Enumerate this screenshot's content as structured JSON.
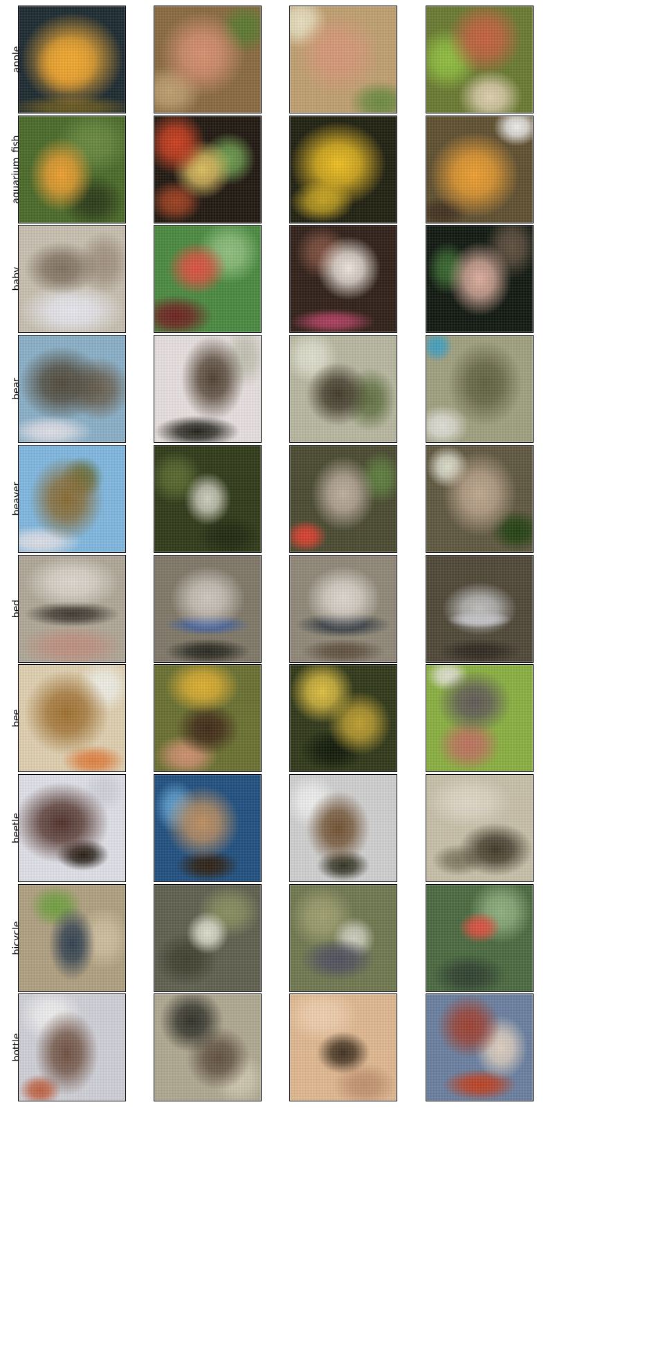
{
  "rows": [
    {
      "label": "apple",
      "images": [
        {
          "bg": "#1c2a30",
          "blobs": [
            [
              "#f0a830",
              50,
              50,
              48,
              44
            ],
            [
              "#e89020",
              45,
              55,
              30,
              28
            ],
            [
              "#6a5a20",
              50,
              95,
              60,
              12
            ]
          ]
        },
        {
          "bg": "#8a6a40",
          "blobs": [
            [
              "#d89070",
              45,
              45,
              40,
              40
            ],
            [
              "#5a7a30",
              85,
              20,
              25,
              25
            ],
            [
              "#c0a070",
              15,
              80,
              30,
              25
            ]
          ]
        },
        {
          "bg": "#c0a070",
          "blobs": [
            [
              "#d89878",
              45,
              45,
              40,
              40
            ],
            [
              "#e8e0c0",
              10,
              15,
              25,
              25
            ],
            [
              "#6a8a40",
              85,
              90,
              30,
              20
            ]
          ]
        },
        {
          "bg": "#6a7a30",
          "blobs": [
            [
              "#c86040",
              55,
              30,
              35,
              35
            ],
            [
              "#90c040",
              20,
              50,
              30,
              30
            ],
            [
              "#e0d0b0",
              60,
              85,
              30,
              25
            ]
          ]
        }
      ]
    },
    {
      "label": "aquarium_fish",
      "images": [
        {
          "bg": "#4a6a28",
          "blobs": [
            [
              "#f0a030",
              40,
              55,
              30,
              35
            ],
            [
              "#6a8a40",
              70,
              25,
              35,
              30
            ],
            [
              "#2a3a18",
              70,
              80,
              30,
              25
            ]
          ]
        },
        {
          "bg": "#201810",
          "blobs": [
            [
              "#d04020",
              20,
              25,
              28,
              30
            ],
            [
              "#e0c060",
              45,
              50,
              28,
              28
            ],
            [
              "#70a050",
              70,
              40,
              25,
              25
            ],
            [
              "#a04020",
              20,
              80,
              25,
              20
            ]
          ]
        },
        {
          "bg": "#202010",
          "blobs": [
            [
              "#f0c020",
              45,
              45,
              45,
              40
            ],
            [
              "#403020",
              50,
              45,
              15,
              15
            ],
            [
              "#c0a020",
              30,
              80,
              30,
              20
            ]
          ]
        },
        {
          "bg": "#605030",
          "blobs": [
            [
              "#f0a030",
              45,
              55,
              42,
              40
            ],
            [
              "#f0f0f0",
              85,
              10,
              22,
              18
            ],
            [
              "#403020",
              15,
              90,
              25,
              15
            ]
          ]
        }
      ]
    },
    {
      "label": "baby",
      "images": [
        {
          "bg": "#c8c0b0",
          "blobs": [
            [
              "#807060",
              40,
              40,
              35,
              25
            ],
            [
              "#e8e8f0",
              50,
              80,
              50,
              25
            ],
            [
              "#a09080",
              80,
              35,
              25,
              30
            ]
          ]
        },
        {
          "bg": "#4a8a40",
          "blobs": [
            [
              "#e05040",
              40,
              40,
              28,
              25
            ],
            [
              "#90c080",
              70,
              25,
              30,
              30
            ],
            [
              "#702020",
              20,
              85,
              35,
              20
            ]
          ]
        },
        {
          "bg": "#302018",
          "blobs": [
            [
              "#f0e8e0",
              55,
              40,
              30,
              30
            ],
            [
              "#805040",
              30,
              25,
              25,
              25
            ],
            [
              "#b04060",
              40,
              90,
              40,
              12
            ]
          ]
        },
        {
          "bg": "#101810",
          "blobs": [
            [
              "#e0b0a0",
              50,
              50,
              30,
              35
            ],
            [
              "#3a6a30",
              20,
              40,
              20,
              25
            ],
            [
              "#605040",
              80,
              20,
              25,
              30
            ]
          ]
        }
      ]
    },
    {
      "label": "bear",
      "images": [
        {
          "bg": "#8ab0c8",
          "blobs": [
            [
              "#504838",
              40,
              45,
              40,
              35
            ],
            [
              "#6a6050",
              75,
              50,
              30,
              30
            ],
            [
              "#e0e0e8",
              30,
              90,
              40,
              15
            ]
          ]
        },
        {
          "bg": "#e8e0e0",
          "blobs": [
            [
              "#504030",
              55,
              40,
              30,
              40
            ],
            [
              "#202018",
              40,
              90,
              40,
              15
            ],
            [
              "#c0c0b0",
              85,
              20,
              20,
              30
            ]
          ]
        },
        {
          "bg": "#b8b8a0",
          "blobs": [
            [
              "#403828",
              45,
              55,
              30,
              30
            ],
            [
              "#e0e0d0",
              20,
              20,
              25,
              25
            ],
            [
              "#607040",
              75,
              60,
              25,
              30
            ]
          ]
        },
        {
          "bg": "#a0a080",
          "blobs": [
            [
              "#606040",
              55,
              45,
              35,
              40
            ],
            [
              "#e0e0d8",
              15,
              85,
              25,
              20
            ],
            [
              "#40a0c0",
              10,
              10,
              15,
              15
            ]
          ]
        }
      ]
    },
    {
      "label": "beaver",
      "images": [
        {
          "bg": "#80b8e0",
          "blobs": [
            [
              "#8a6a30",
              45,
              50,
              35,
              40
            ],
            [
              "#e0e0e8",
              20,
              90,
              40,
              15
            ],
            [
              "#607040",
              60,
              30,
              20,
              20
            ]
          ]
        },
        {
          "bg": "#303a18",
          "blobs": [
            [
              "#d0d0c0",
              50,
              50,
              22,
              25
            ],
            [
              "#5a6a30",
              20,
              30,
              25,
              25
            ],
            [
              "#202810",
              70,
              85,
              30,
              20
            ]
          ]
        },
        {
          "bg": "#4a4a30",
          "blobs": [
            [
              "#c0b0a0",
              50,
              45,
              30,
              35
            ],
            [
              "#e04030",
              15,
              85,
              20,
              15
            ],
            [
              "#608040",
              85,
              30,
              20,
              25
            ]
          ]
        },
        {
          "bg": "#605840",
          "blobs": [
            [
              "#c0a890",
              50,
              45,
              35,
              40
            ],
            [
              "#204010",
              85,
              80,
              25,
              20
            ],
            [
              "#e0e0d0",
              20,
              20,
              20,
              20
            ]
          ]
        }
      ]
    },
    {
      "label": "bed",
      "images": [
        {
          "bg": "#b0a898",
          "blobs": [
            [
              "#e0d8d0",
              50,
              25,
              45,
              25
            ],
            [
              "#403830",
              50,
              55,
              45,
              12
            ],
            [
              "#c09080",
              50,
              85,
              50,
              20
            ]
          ]
        },
        {
          "bg": "#807868",
          "blobs": [
            [
              "#d0c8c0",
              50,
              40,
              35,
              30
            ],
            [
              "#4060a0",
              50,
              65,
              40,
              10
            ],
            [
              "#282820",
              50,
              90,
              40,
              12
            ]
          ]
        },
        {
          "bg": "#908878",
          "blobs": [
            [
              "#e0d8d0",
              50,
              40,
              35,
              30
            ],
            [
              "#303840",
              50,
              65,
              45,
              12
            ],
            [
              "#605040",
              50,
              90,
              40,
              12
            ]
          ]
        },
        {
          "bg": "#504838",
          "blobs": [
            [
              "#c0c0c0",
              50,
              50,
              35,
              25
            ],
            [
              "#e0e0f0",
              50,
              60,
              30,
              8
            ],
            [
              "#302820",
              50,
              90,
              40,
              12
            ]
          ]
        }
      ]
    },
    {
      "label": "bee",
      "images": [
        {
          "bg": "#e0d0b0",
          "blobs": [
            [
              "#a07030",
              45,
              45,
              40,
              40
            ],
            [
              "#f0f0e8",
              80,
              20,
              25,
              25
            ],
            [
              "#e08040",
              70,
              90,
              30,
              15
            ]
          ]
        },
        {
          "bg": "#6a7030",
          "blobs": [
            [
              "#e0b030",
              45,
              20,
              35,
              25
            ],
            [
              "#402818",
              50,
              60,
              30,
              25
            ],
            [
              "#d09070",
              30,
              85,
              30,
              20
            ]
          ]
        },
        {
          "bg": "#303818",
          "blobs": [
            [
              "#e0c040",
              30,
              25,
              30,
              30
            ],
            [
              "#c0a030",
              65,
              55,
              30,
              30
            ],
            [
              "#101808",
              40,
              80,
              30,
              20
            ]
          ]
        },
        {
          "bg": "#8ab040",
          "blobs": [
            [
              "#605858",
              45,
              35,
              35,
              30
            ],
            [
              "#c07060",
              40,
              75,
              30,
              25
            ],
            [
              "#e0e0d0",
              20,
              10,
              20,
              15
            ]
          ]
        }
      ]
    },
    {
      "label": "beetle",
      "images": [
        {
          "bg": "#e0e0e8",
          "blobs": [
            [
              "#503028",
              40,
              45,
              45,
              38
            ],
            [
              "#201810",
              60,
              75,
              25,
              15
            ],
            [
              "#d0d0d8",
              80,
              15,
              20,
              20
            ]
          ]
        },
        {
          "bg": "#205080",
          "blobs": [
            [
              "#c09060",
              45,
              45,
              35,
              35
            ],
            [
              "#60a0d0",
              20,
              30,
              20,
              25
            ],
            [
              "#302010",
              50,
              85,
              30,
              15
            ]
          ]
        },
        {
          "bg": "#d0d0d0",
          "blobs": [
            [
              "#705030",
              45,
              50,
              30,
              35
            ],
            [
              "#f0f0f0",
              20,
              25,
              25,
              25
            ],
            [
              "#303020",
              50,
              85,
              25,
              15
            ]
          ]
        },
        {
          "bg": "#c8c0a8",
          "blobs": [
            [
              "#403828",
              65,
              70,
              35,
              25
            ],
            [
              "#e0d8c8",
              40,
              25,
              40,
              25
            ],
            [
              "#807860",
              30,
              80,
              25,
              15
            ]
          ]
        }
      ]
    },
    {
      "label": "bicycle",
      "images": [
        {
          "bg": "#b0a080",
          "blobs": [
            [
              "#304050",
              50,
              55,
              22,
              35
            ],
            [
              "#70a040",
              35,
              20,
              25,
              20
            ],
            [
              "#d0c0a0",
              80,
              50,
              25,
              30
            ]
          ]
        },
        {
          "bg": "#606050",
          "blobs": [
            [
              "#e0e0d0",
              50,
              45,
              20,
              20
            ],
            [
              "#404030",
              30,
              70,
              30,
              25
            ],
            [
              "#8a9060",
              70,
              25,
              30,
              25
            ]
          ]
        },
        {
          "bg": "#707850",
          "blobs": [
            [
              "#505060",
              45,
              70,
              35,
              20
            ],
            [
              "#d0d0c0",
              60,
              50,
              20,
              20
            ],
            [
              "#a0a070",
              30,
              30,
              30,
              30
            ]
          ]
        },
        {
          "bg": "#4a6a40",
          "blobs": [
            [
              "#e05040",
              50,
              40,
              20,
              15
            ],
            [
              "#90b080",
              70,
              25,
              30,
              30
            ],
            [
              "#304030",
              40,
              85,
              35,
              20
            ]
          ]
        }
      ]
    },
    {
      "label": "bottle",
      "images": [
        {
          "bg": "#d0d0d8",
          "blobs": [
            [
              "#705040",
              45,
              55,
              30,
              40
            ],
            [
              "#f0f0f0",
              30,
              20,
              30,
              25
            ],
            [
              "#c06040",
              20,
              90,
              20,
              15
            ]
          ]
        },
        {
          "bg": "#b0a890",
          "blobs": [
            [
              "#303028",
              35,
              25,
              30,
              30
            ],
            [
              "#605040",
              60,
              60,
              30,
              30
            ],
            [
              "#d0c8b0",
              80,
              80,
              25,
              25
            ]
          ]
        },
        {
          "bg": "#e0b890",
          "blobs": [
            [
              "#403020",
              50,
              55,
              25,
              20
            ],
            [
              "#f0d0b0",
              30,
              20,
              35,
              25
            ],
            [
              "#c09070",
              70,
              85,
              30,
              20
            ]
          ]
        },
        {
          "bg": "#6a80a0",
          "blobs": [
            [
              "#a04030",
              40,
              30,
              30,
              30
            ],
            [
              "#e0d0c0",
              70,
              50,
              25,
              30
            ],
            [
              "#c04020",
              50,
              85,
              35,
              15
            ]
          ]
        }
      ]
    }
  ]
}
